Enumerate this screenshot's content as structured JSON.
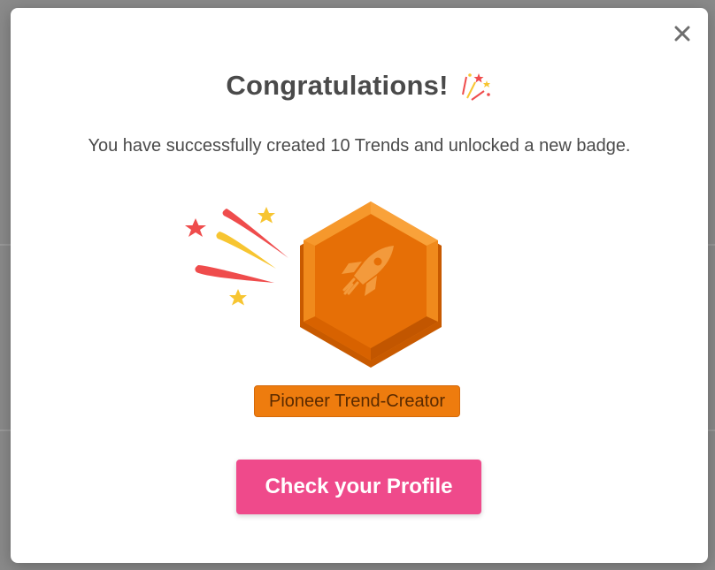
{
  "modal": {
    "title": "Congratulations!",
    "subtitle": "You have successfully created 10 Trends and unlocked a new badge.",
    "badge": {
      "label": "Pioneer Trend-Creator",
      "icon": "rocket-icon"
    },
    "cta_label": "Check your Profile",
    "close_icon": "close-icon"
  },
  "colors": {
    "title": "#4a4a4a",
    "badge_orange": "#ee7c0e",
    "cta_pink": "#ef4a8b",
    "star_yellow": "#f7c531",
    "star_red": "#ef4c4c"
  }
}
